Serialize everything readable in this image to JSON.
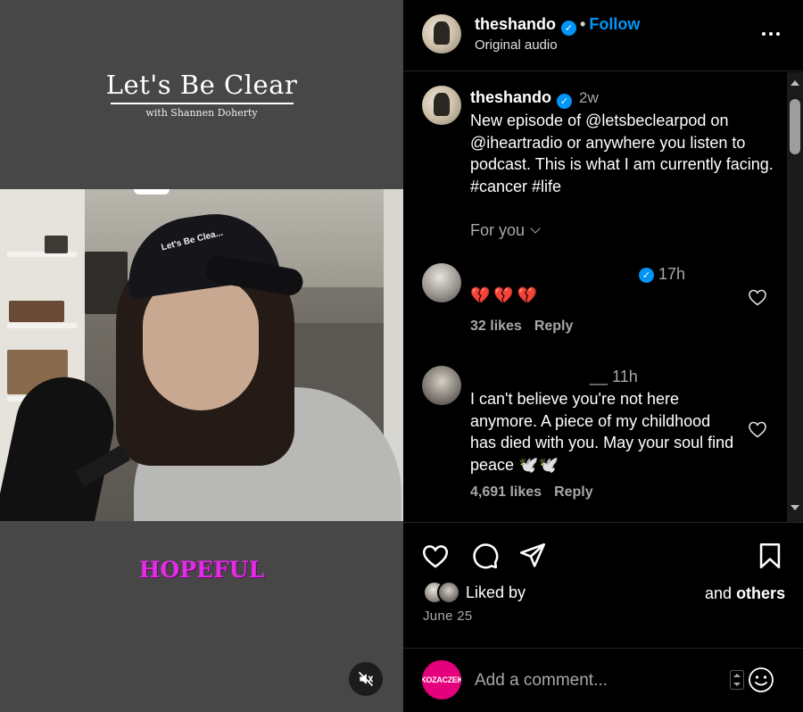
{
  "media": {
    "brand_title": "Let's Be Clear",
    "brand_subtitle": "with Shannen Doherty",
    "cap_text": "Let's Be Clea...",
    "overlay_caption": "HOPEFUL",
    "overlay_color": "#e22ce6",
    "mute_icon": "speaker-muted-icon"
  },
  "header": {
    "username": "theshando",
    "separator": "•",
    "follow_label": "Follow",
    "subtitle": "Original audio",
    "more_icon": "more-horizontal-icon"
  },
  "caption": {
    "username": "theshando",
    "time": "2w",
    "text": "New episode of @letsbeclearpod on @iheartradio or anywhere you listen to podcast. This is what I am currently facing. #cancer #life",
    "for_you_label": "For you"
  },
  "comments": [
    {
      "time": "17h",
      "text": "💔💔💔",
      "likes": "32 likes",
      "reply_label": "Reply"
    },
    {
      "username_fragment": "__",
      "time": "11h",
      "text": "I can't believe you're not here anymore. A piece of my childhood has died with you. May your soul find peace 🕊️🕊️",
      "likes": "4,691 likes",
      "reply_label": "Reply"
    }
  ],
  "actions": {
    "like_icon": "heart-icon",
    "comment_icon": "comment-bubble-icon",
    "share_icon": "paper-plane-icon",
    "save_icon": "bookmark-icon"
  },
  "likes_summary": {
    "liked_by_label": "Liked by",
    "and_label": "and",
    "others_label": "others",
    "date": "June 25"
  },
  "compose": {
    "avatar_text": "KOZACZEK",
    "placeholder": "Add a comment...",
    "emoji_icon": "smiley-icon"
  },
  "colors": {
    "accent": "#0095f6",
    "heart_red": "#d4152f",
    "background": "#000000",
    "muted_text": "#a8a8a8"
  }
}
